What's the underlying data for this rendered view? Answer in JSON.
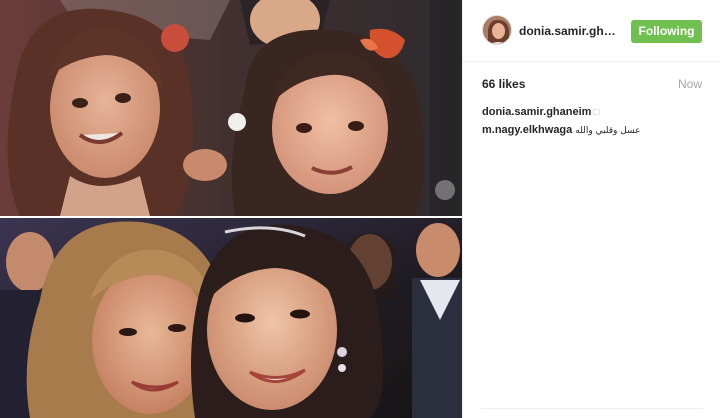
{
  "post": {
    "image_alt": "Two girls as children (top) and the same two women smiling at an event (bottom)"
  },
  "header": {
    "username": "donia.samir.ghaneim",
    "follow_label": "Following",
    "follow_color": "#70c050"
  },
  "stats": {
    "likes": "66 likes",
    "time": "Now"
  },
  "comments": [
    {
      "user": "donia.samir.ghaneim",
      "glyph": "□",
      "text": ""
    },
    {
      "user": "m.nagy.elkhwaga",
      "glyph": "",
      "text": "عسل وقلبي والله"
    }
  ],
  "icons": {
    "avatar": "user-avatar-photo",
    "caption_glyph": "emoji-placeholder-box"
  }
}
